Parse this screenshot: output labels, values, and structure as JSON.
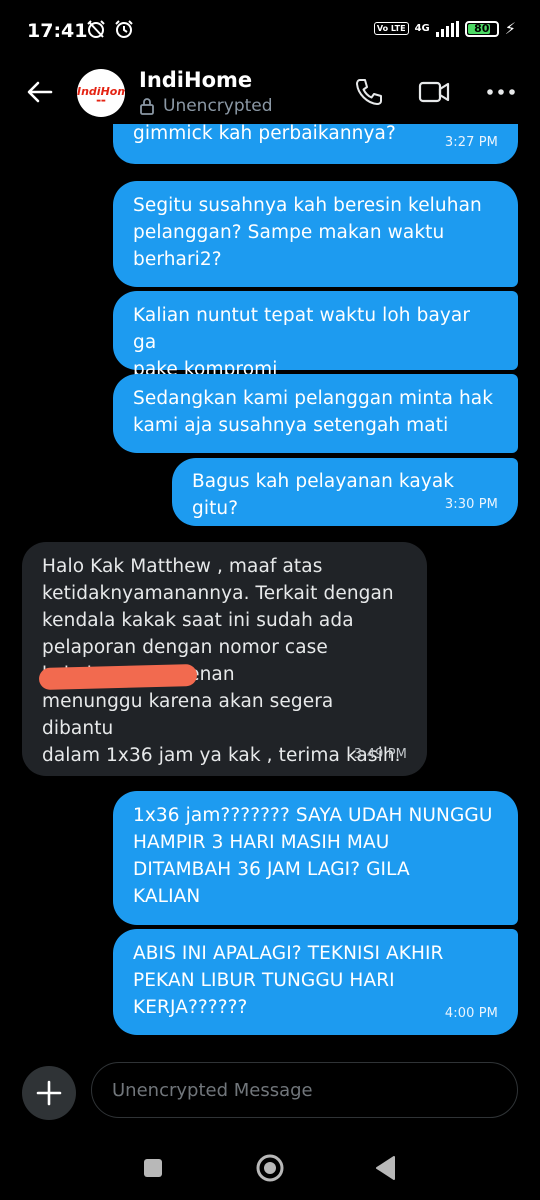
{
  "status_bar": {
    "time": "17:41",
    "network_badge": "Vo LTE",
    "network_type": "4G",
    "battery": "80",
    "battery_level": 0.8
  },
  "header": {
    "contact_name": "IndiHome",
    "encryption_status": "Unencrypted",
    "avatar_logo": "IndiHome",
    "icons": [
      "back-arrow-icon",
      "lock-icon",
      "phone-icon",
      "video-icon",
      "more-icon"
    ]
  },
  "messages": [
    {
      "side": "out",
      "text": "gimmick kah perbaikannya?",
      "time": "3:27 PM"
    },
    {
      "side": "out",
      "text": "Segitu susahnya kah beresin keluhan\npelanggan? Sampe makan waktu\nberhari2?",
      "time": ""
    },
    {
      "side": "out",
      "text": "Kalian nuntut tepat waktu loh bayar ga\npake kompromi",
      "time": ""
    },
    {
      "side": "out",
      "text": "Sedangkan kami pelanggan minta hak\nkami aja susahnya setengah mati",
      "time": ""
    },
    {
      "side": "out",
      "text": "Bagus kah pelayanan kayak gitu?",
      "time": "3:30 PM"
    },
    {
      "side": "in",
      "text": "Halo Kak Matthew , maaf atas\nketidaknyamanannya. Terkait dengan\nkendala kakak saat ini sudah ada\npelaporan dengan nomor case\n                          kak, harap berkenan\nmenunggu karena akan segera dibantu\ndalam 1x36 jam ya kak , terima kasih.",
      "time": "3:49 PM"
    },
    {
      "side": "out",
      "text": "1x36 jam??????? SAYA UDAH NUNGGU\nHAMPIR 3 HARI MASIH MAU\nDITAMBAH 36 JAM LAGI? GILA\nKALIAN",
      "time": ""
    },
    {
      "side": "out",
      "text": "ABIS INI APALAGI? TEKNISI AKHIR\nPEKAN LIBUR TUNGGU HARI\nKERJA??????",
      "time": "4:00 PM"
    }
  ],
  "composer": {
    "placeholder": "Unencrypted Message"
  },
  "colors": {
    "outgoing_bubble": "#1d9bf0",
    "incoming_bubble": "#202327",
    "background": "#000000",
    "redaction": "#f26a4f"
  }
}
